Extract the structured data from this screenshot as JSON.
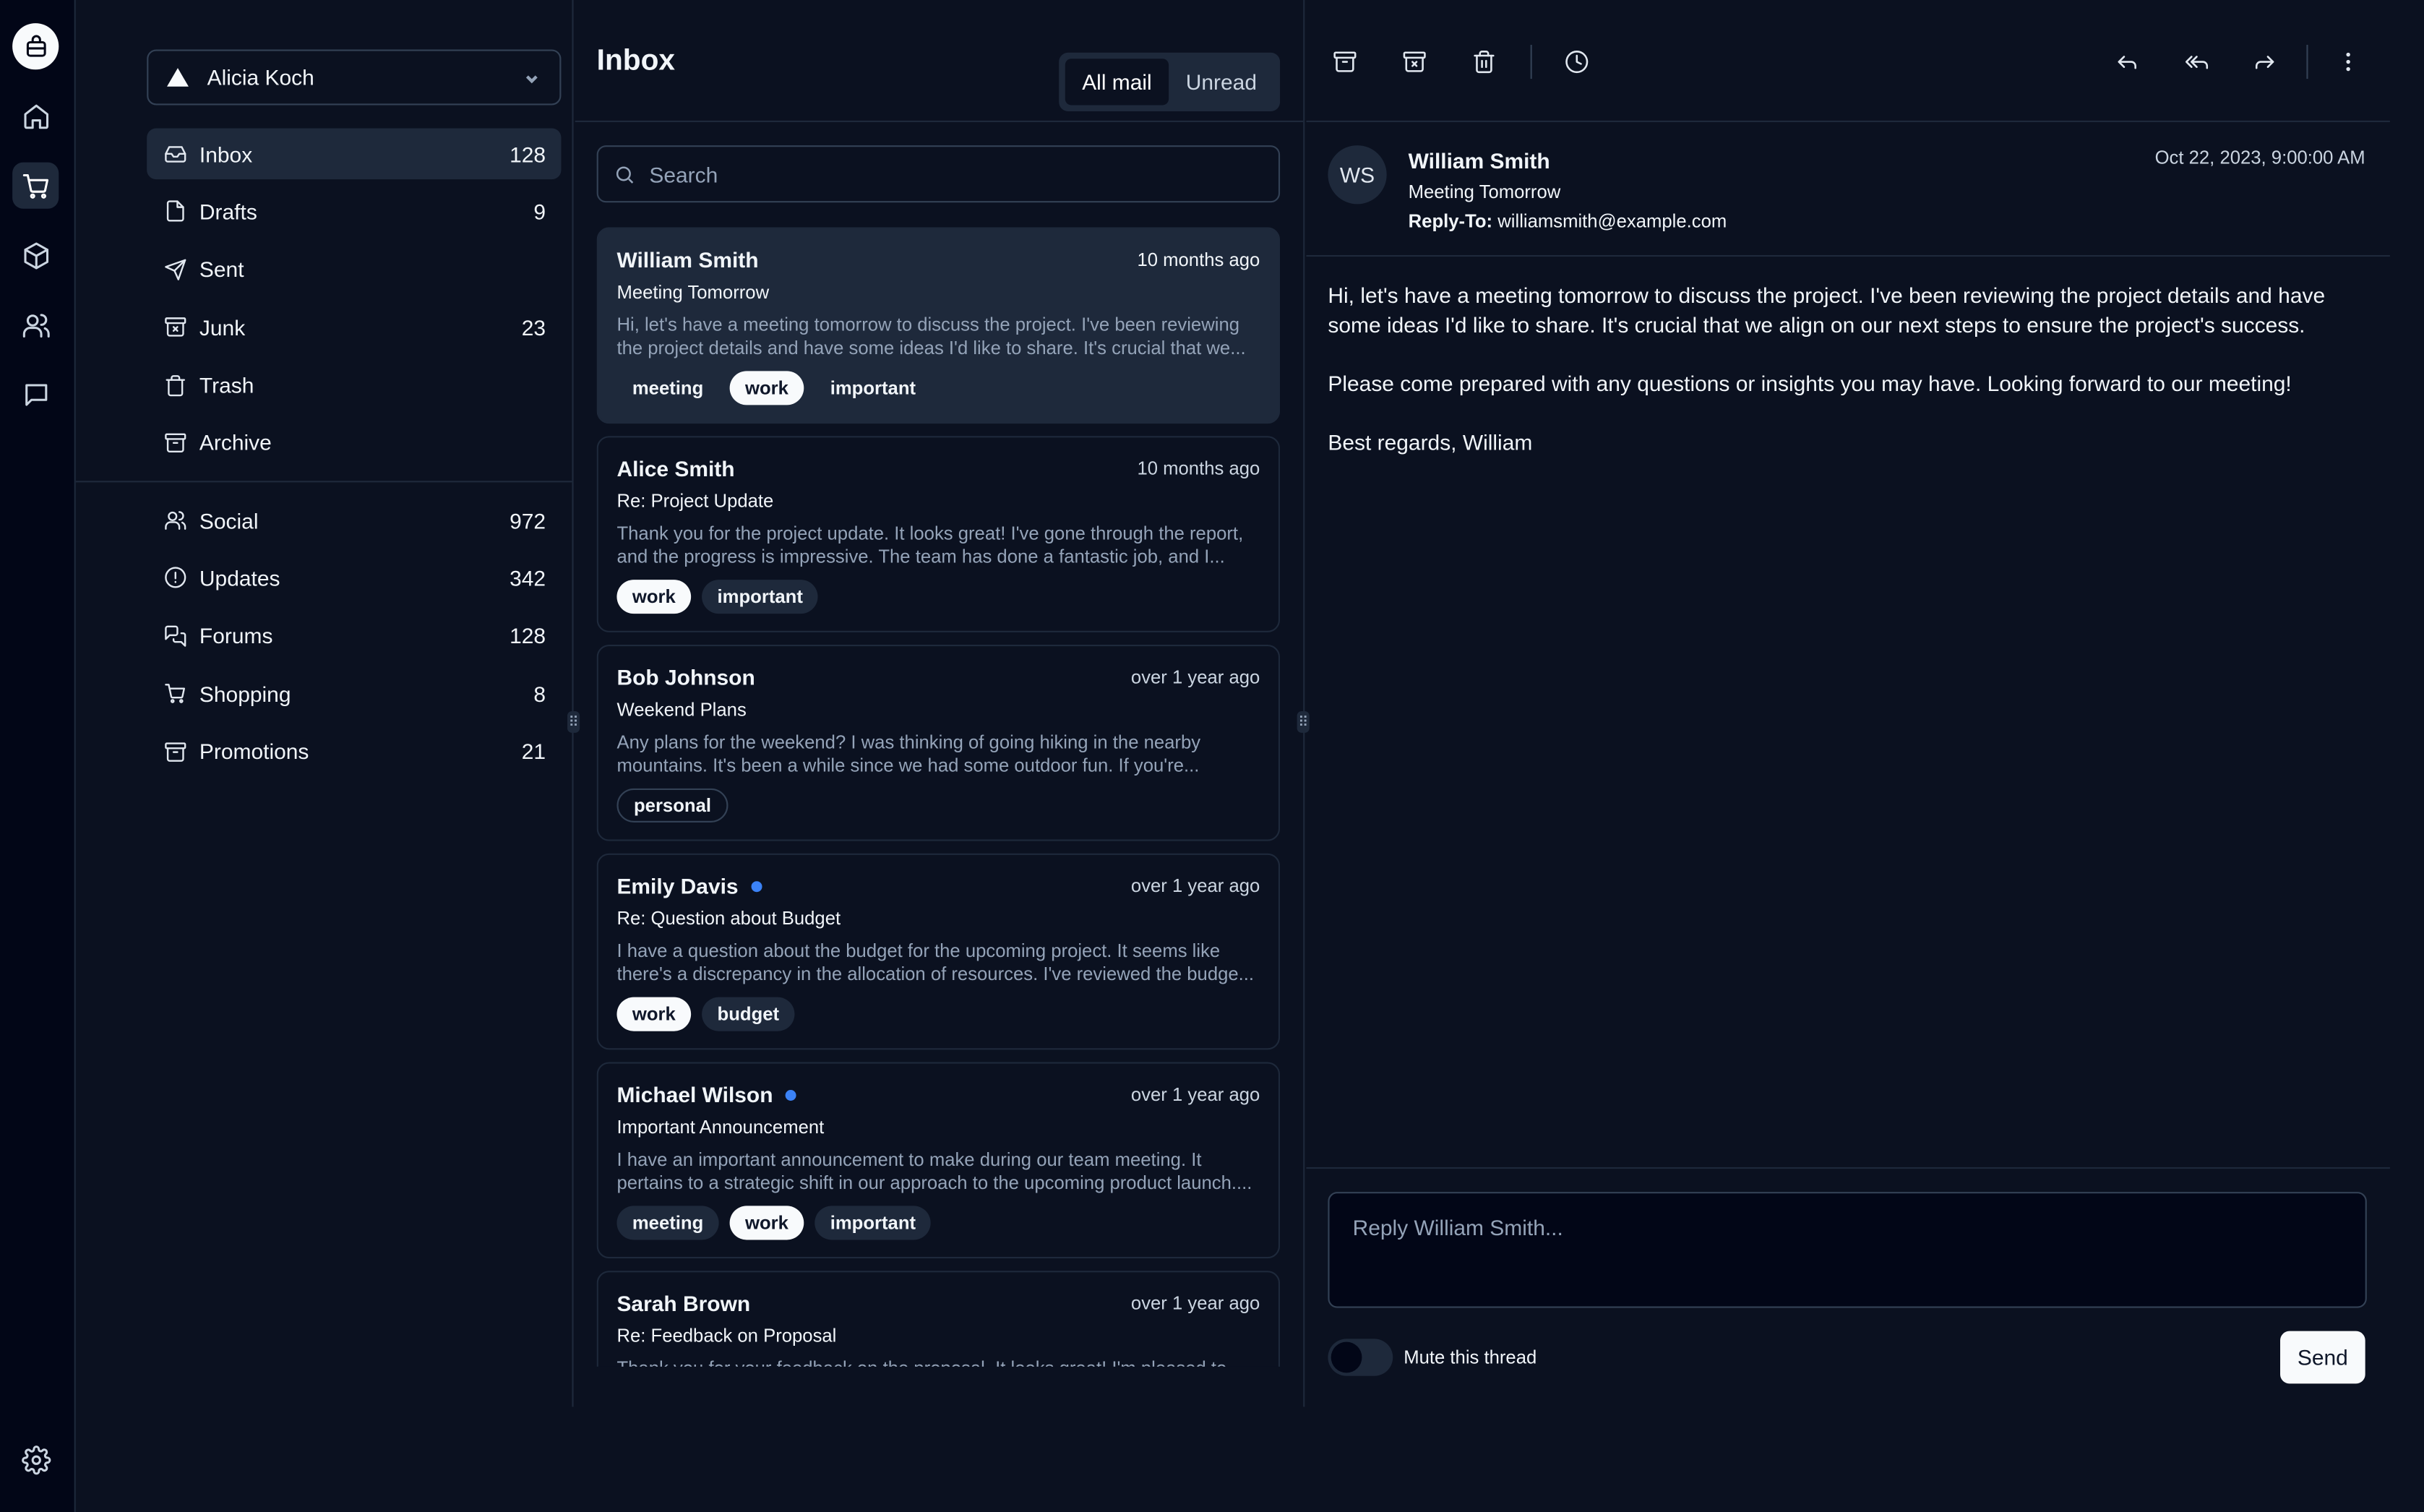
{
  "rail": {
    "items": [
      {
        "name": "logo-icon"
      },
      {
        "name": "home-icon"
      },
      {
        "name": "cart-icon"
      },
      {
        "name": "package-icon"
      },
      {
        "name": "users-icon"
      },
      {
        "name": "message-icon"
      },
      {
        "name": "settings-icon"
      }
    ]
  },
  "account": {
    "name": "Alicia Koch"
  },
  "nav": {
    "primary": [
      {
        "label": "Inbox",
        "count": "128",
        "icon": "inbox-icon"
      },
      {
        "label": "Drafts",
        "count": "9",
        "icon": "file-icon"
      },
      {
        "label": "Sent",
        "count": "",
        "icon": "send-icon"
      },
      {
        "label": "Junk",
        "count": "23",
        "icon": "archive-x-icon"
      },
      {
        "label": "Trash",
        "count": "",
        "icon": "trash-icon"
      },
      {
        "label": "Archive",
        "count": "",
        "icon": "archive-icon"
      }
    ],
    "secondary": [
      {
        "label": "Social",
        "count": "972",
        "icon": "users-icon"
      },
      {
        "label": "Updates",
        "count": "342",
        "icon": "alert-circle-icon"
      },
      {
        "label": "Forums",
        "count": "128",
        "icon": "messages-icon"
      },
      {
        "label": "Shopping",
        "count": "8",
        "icon": "cart-icon"
      },
      {
        "label": "Promotions",
        "count": "21",
        "icon": "archive-icon"
      }
    ]
  },
  "list": {
    "title": "Inbox",
    "filters": {
      "all": "All mail",
      "unread": "Unread"
    },
    "search_placeholder": "Search",
    "mails": [
      {
        "from": "William Smith",
        "time": "10 months ago",
        "subject": "Meeting Tomorrow",
        "preview": "Hi, let's have a meeting tomorrow to discuss the project. I've been reviewing the project details and have some ideas I'd like to share. It's crucial that we...",
        "tags": [
          "meeting",
          "work",
          "important"
        ],
        "unread": false
      },
      {
        "from": "Alice Smith",
        "time": "10 months ago",
        "subject": "Re: Project Update",
        "preview": "Thank you for the project update. It looks great! I've gone through the report, and the progress is impressive. The team has done a fantastic job, and I...",
        "tags": [
          "work",
          "important"
        ],
        "unread": false
      },
      {
        "from": "Bob Johnson",
        "time": "over 1 year ago",
        "subject": "Weekend Plans",
        "preview": "Any plans for the weekend? I was thinking of going hiking in the nearby mountains. It's been a while since we had some outdoor fun. If you're...",
        "tags": [
          "personal"
        ],
        "unread": false
      },
      {
        "from": "Emily Davis",
        "time": "over 1 year ago",
        "subject": "Re: Question about Budget",
        "preview": "I have a question about the budget for the upcoming project. It seems like there's a discrepancy in the allocation of resources. I've reviewed the budge...",
        "tags": [
          "work",
          "budget"
        ],
        "unread": true
      },
      {
        "from": "Michael Wilson",
        "time": "over 1 year ago",
        "subject": "Important Announcement",
        "preview": "I have an important announcement to make during our team meeting. It pertains to a strategic shift in our approach to the upcoming product launch....",
        "tags": [
          "meeting",
          "work",
          "important"
        ],
        "unread": true
      },
      {
        "from": "Sarah Brown",
        "time": "over 1 year ago",
        "subject": "Re: Feedback on Proposal",
        "preview": "Thank you for your feedback on the proposal. It looks great! I'm pleased to...",
        "tags": [],
        "unread": false
      }
    ]
  },
  "detail": {
    "initials": "WS",
    "from": "William Smith",
    "subject": "Meeting Tomorrow",
    "reply_to_label": "Reply-To:",
    "reply_to": "williamsmith@example.com",
    "date": "Oct 22, 2023, 9:00:00 AM",
    "body": "Hi, let's have a meeting tomorrow to discuss the project. I've been reviewing the project details and have some ideas I'd like to share. It's crucial that we align on our next steps to ensure the project's success.\n\nPlease come prepared with any questions or insights you may have. Looking forward to our meeting!\n\nBest regards, William",
    "reply_placeholder": "Reply William Smith...",
    "mute_label": "Mute this thread",
    "send_label": "Send"
  },
  "colors": {
    "background": "#0b1120",
    "accent_dot": "#3b82f6",
    "selected": "#1e293b"
  }
}
